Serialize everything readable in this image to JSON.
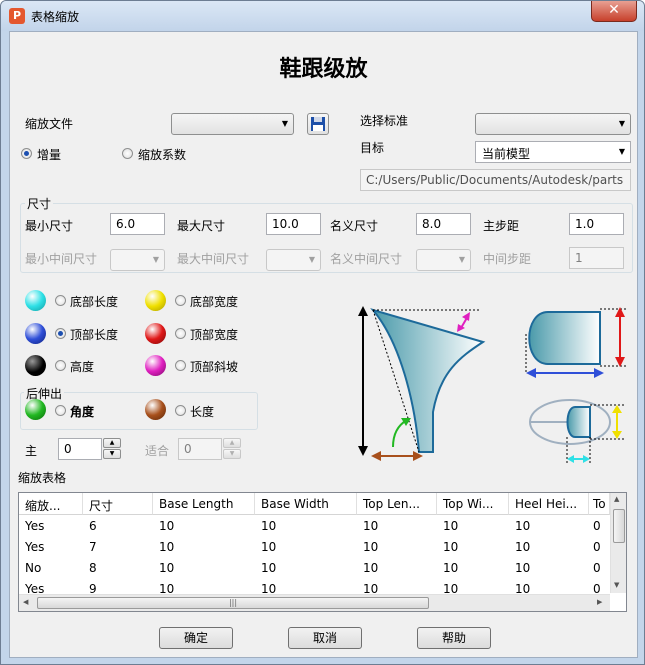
{
  "window": {
    "title": "表格缩放",
    "app_icon": "P",
    "close": "✕"
  },
  "heading": "鞋跟级放",
  "scale_file": {
    "label": "缩放文件",
    "value": ""
  },
  "mode": {
    "increment": "增量",
    "factor": "缩放系数",
    "selected": "increment"
  },
  "standard": {
    "label": "选择标准",
    "value": ""
  },
  "target": {
    "label": "目标",
    "value": "当前模型"
  },
  "path": "C:/Users/Public/Documents/Autodesk/parts",
  "size": {
    "group_label": "尺寸",
    "min_label": "最小尺寸",
    "min": "6.0",
    "max_label": "最大尺寸",
    "max": "10.0",
    "nominal_label": "名义尺寸",
    "nominal": "8.0",
    "step_label": "主步距",
    "step": "1.0",
    "min_mid_label": "最小中间尺寸",
    "max_mid_label": "最大中间尺寸",
    "nominal_mid_label": "名义中间尺寸",
    "mid_step_label": "中间步距",
    "mid_step": "1"
  },
  "options": {
    "base_length": "底部长度",
    "base_width": "底部宽度",
    "top_length": "顶部长度",
    "top_width": "顶部宽度",
    "height": "高度",
    "top_slope": "顶部斜坡",
    "back_group": "后伸出",
    "angle": "角度",
    "length": "长度",
    "selected": "top_length"
  },
  "ball_colors": {
    "cyan": "#2ee0e6",
    "yellow": "#f0e000",
    "blue": "#2f4fd8",
    "red": "#e01818",
    "black": "#000000",
    "magenta": "#e020c0",
    "green": "#22b822",
    "brown": "#a8501c"
  },
  "main": {
    "label": "主",
    "value": "0",
    "fit_label": "适合",
    "fit_value": "0"
  },
  "table": {
    "label": "缩放表格",
    "columns": [
      "缩放...",
      "尺寸",
      "Base Length",
      "Base Width",
      "Top Len...",
      "Top Wi...",
      "Heel Hei...",
      "To"
    ],
    "rows": [
      [
        "Yes",
        "6",
        "10",
        "10",
        "10",
        "10",
        "10",
        "0"
      ],
      [
        "Yes",
        "7",
        "10",
        "10",
        "10",
        "10",
        "10",
        "0"
      ],
      [
        "No",
        "8",
        "10",
        "10",
        "10",
        "10",
        "10",
        "0"
      ],
      [
        "Yes",
        "9",
        "10",
        "10",
        "10",
        "10",
        "10",
        "0"
      ]
    ]
  },
  "buttons": {
    "ok": "确定",
    "cancel": "取消",
    "help": "帮助"
  },
  "icons": {
    "save": "floppy-disk-icon",
    "grip": "|||"
  }
}
